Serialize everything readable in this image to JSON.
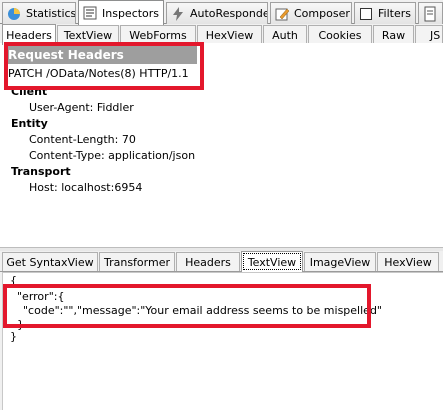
{
  "top_tabs": [
    {
      "label": "Statistics",
      "icon": "statistics-icon"
    },
    {
      "label": "Inspectors",
      "icon": "inspectors-icon"
    },
    {
      "label": "AutoResponder",
      "icon": "lightning-icon"
    },
    {
      "label": "Composer",
      "icon": "composer-icon"
    },
    {
      "label": "Filters",
      "icon": "checkbox-icon"
    },
    {
      "label": "",
      "icon": "log-icon"
    }
  ],
  "request_tabs": [
    "Headers",
    "TextView",
    "WebForms",
    "HexView",
    "Auth",
    "Cookies",
    "Raw",
    "JS"
  ],
  "request_headers": {
    "title": "Request Headers",
    "request_line": "PATCH /OData/Notes(8) HTTP/1.1",
    "sections": [
      {
        "name": "Client",
        "items": [
          "User-Agent: Fiddler"
        ]
      },
      {
        "name": "Entity",
        "items": [
          "Content-Length: 70",
          "Content-Type: application/json"
        ]
      },
      {
        "name": "Transport",
        "items": [
          "Host: localhost:6954"
        ]
      }
    ]
  },
  "response_tabs": [
    "Get SyntaxView",
    "Transformer",
    "Headers",
    "TextView",
    "ImageView",
    "HexView"
  ],
  "response_body": {
    "lines": [
      "{",
      "\"error\":{",
      "\"code\":\"\",\"message\":\"Your email address seems to be mispelled\"",
      "}",
      "}"
    ]
  },
  "colors": {
    "highlight": "#e3172c",
    "title_bar": "#9e9e9e"
  }
}
